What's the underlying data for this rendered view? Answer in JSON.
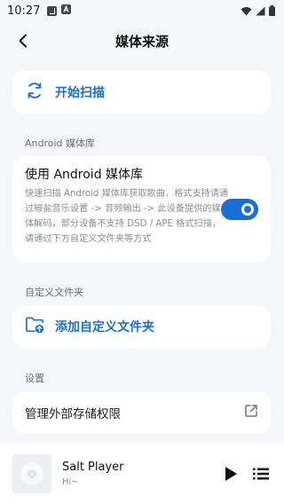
{
  "status_bar": {
    "time": "10:27",
    "icons": [
      "app-notification-icon",
      "a-notification-icon",
      "wifi-icon",
      "signal-icon",
      "battery-icon"
    ]
  },
  "header": {
    "title": "媒体来源",
    "back_icon": "arrow-back-icon"
  },
  "scan_card": {
    "label": "开始扫描",
    "icon": "refresh-icon"
  },
  "android_section": {
    "header": "Android 媒体库",
    "setting_title": "使用 Android 媒体库",
    "setting_desc": "快速扫描 Android 媒体库获取歌曲，格式支持请通过椒盐音乐设置 -> 音频输出 -> 此设备提供的媒体解码，部分设备不支持 DSD / APE 格式扫描，请通过下方自定义文件夹等方式",
    "toggle_on": true
  },
  "custom_folder_section": {
    "header": "自定义文件夹",
    "add_label": "添加自定义文件夹",
    "icon": "folder-add-icon"
  },
  "settings_section": {
    "header": "设置",
    "storage_label": "管理外部存储权限",
    "icon": "open-external-icon"
  },
  "player": {
    "title": "Salt Player",
    "subtitle": "Hi~",
    "play_icon": "play-icon",
    "queue_icon": "queue-list-icon"
  },
  "colors": {
    "accent": "#1a6fd6",
    "background": "#f4f6fa",
    "card": "#ffffff"
  }
}
